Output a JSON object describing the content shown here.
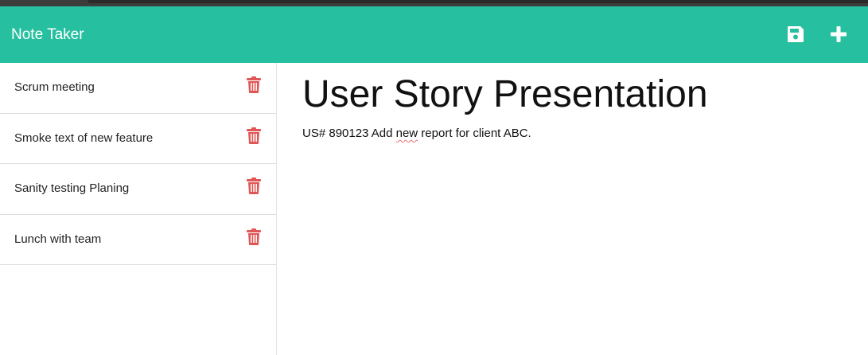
{
  "app": {
    "title": "Note Taker"
  },
  "toolbar": {
    "save_icon": "floppy-disk",
    "add_icon": "plus"
  },
  "sidebar": {
    "delete_icon": "trash-can",
    "delete_color": "#e05555",
    "items": [
      {
        "label": "Scrum meeting"
      },
      {
        "label": "Smoke text of new feature"
      },
      {
        "label": "Sanity testing Planing"
      },
      {
        "label": "Lunch with team"
      }
    ]
  },
  "note": {
    "title": "User Story Presentation",
    "body_before": "US# 890123 Add ",
    "body_flagged": "new",
    "body_after": " report for client ABC."
  },
  "colors": {
    "navbar": "#26bf9f",
    "text": "#222222"
  }
}
